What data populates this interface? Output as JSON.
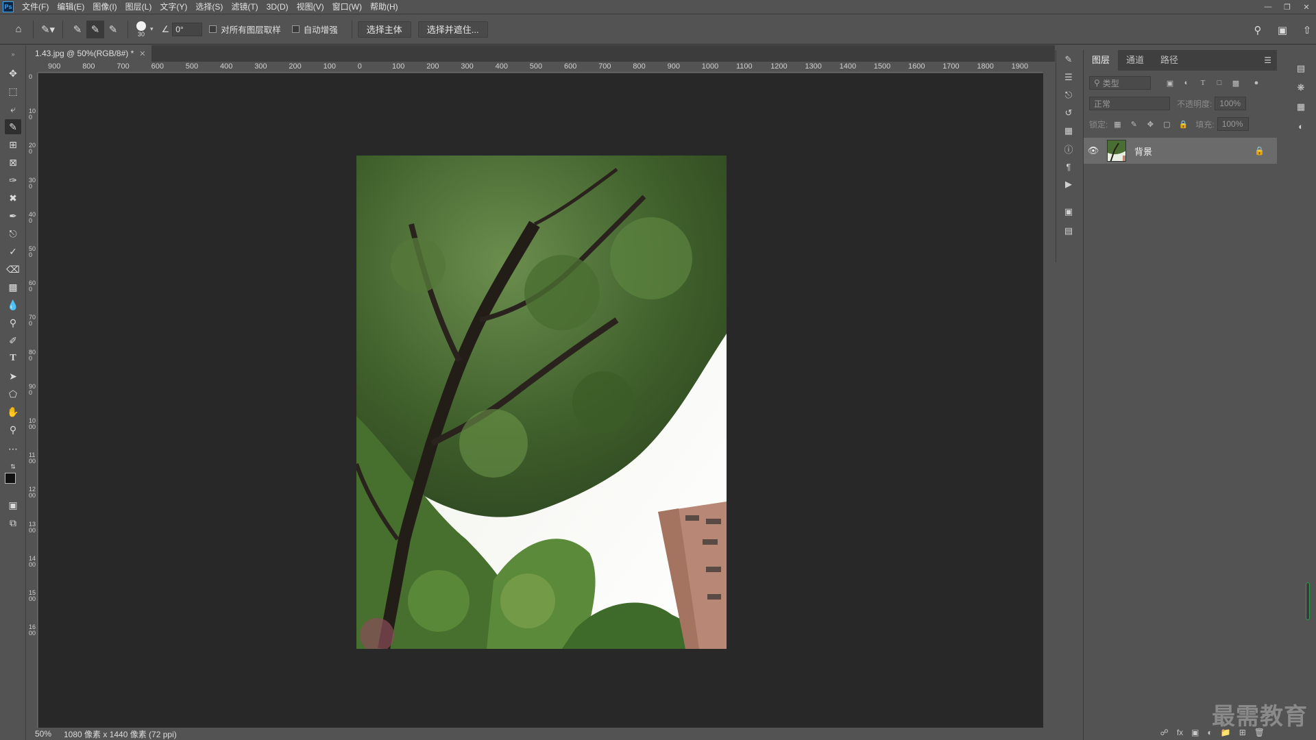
{
  "app": {
    "logo": "Ps"
  },
  "menu": [
    "文件(F)",
    "编辑(E)",
    "图像(I)",
    "图层(L)",
    "文字(Y)",
    "选择(S)",
    "滤镜(T)",
    "3D(D)",
    "视图(V)",
    "窗口(W)",
    "帮助(H)"
  ],
  "options": {
    "brush_size": "30",
    "angle": "0°",
    "sample_all_layers": "对所有图层取样",
    "auto_enhance": "自动增强",
    "select_subject": "选择主体",
    "select_and_mask": "选择并遮住..."
  },
  "document": {
    "tab_title": "1.43.jpg @ 50%(RGB/8#) *"
  },
  "rulers": {
    "top": [
      "900",
      "800",
      "700",
      "600",
      "500",
      "400",
      "300",
      "200",
      "100",
      "0",
      "100",
      "200",
      "300",
      "400",
      "500",
      "600",
      "700",
      "800",
      "900",
      "1000",
      "1100",
      "1200",
      "1300",
      "1400",
      "1500",
      "1600",
      "1700",
      "1800",
      "1900"
    ],
    "left": [
      "0",
      "100",
      "200",
      "300",
      "400",
      "500",
      "600",
      "700",
      "800",
      "900",
      "1000",
      "1100",
      "1200",
      "1300",
      "1400",
      "1500",
      "1600"
    ]
  },
  "status": {
    "zoom": "50%",
    "info": "1080 像素 x 1440 像素 (72 ppi)"
  },
  "layers_panel": {
    "tabs": [
      "图层",
      "通道",
      "路径"
    ],
    "filter_placeholder": "类型",
    "blend_mode": "正常",
    "opacity_label": "不透明度:",
    "opacity_value": "100%",
    "lock_label": "锁定:",
    "fill_label": "填充:",
    "fill_value": "100%",
    "layers": [
      {
        "name": "背景"
      }
    ]
  },
  "watermark": "最需教育"
}
